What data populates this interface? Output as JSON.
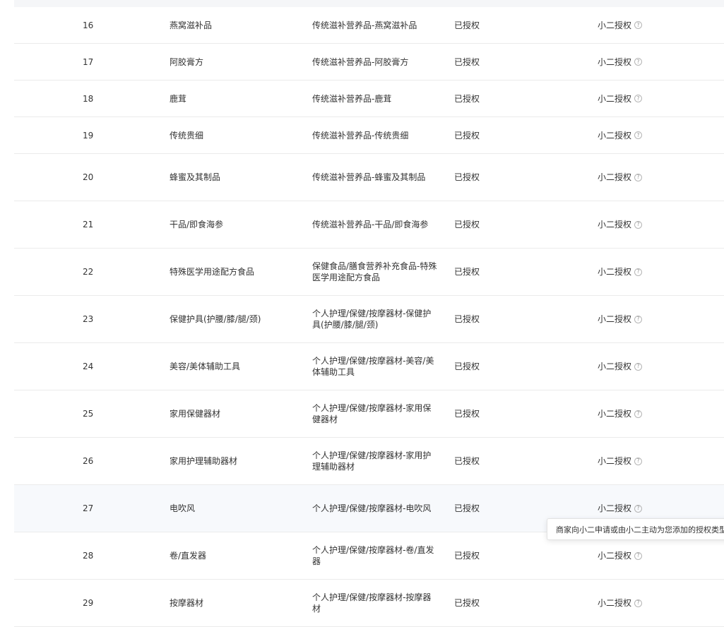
{
  "rows": [
    {
      "index": "16",
      "name": "燕窝滋补品",
      "category_path": "传统滋补营养品-燕窝滋补品",
      "status": "已授权",
      "auth_type": "小二授权"
    },
    {
      "index": "17",
      "name": "阿胶膏方",
      "category_path": "传统滋补营养品-阿胶膏方",
      "status": "已授权",
      "auth_type": "小二授权"
    },
    {
      "index": "18",
      "name": "鹿茸",
      "category_path": "传统滋补营养品-鹿茸",
      "status": "已授权",
      "auth_type": "小二授权"
    },
    {
      "index": "19",
      "name": "传统贵细",
      "category_path": "传统滋补营养品-传统贵细",
      "status": "已授权",
      "auth_type": "小二授权"
    },
    {
      "index": "20",
      "name": "蜂蜜及其制品",
      "category_path": "传统滋补营养品-蜂蜜及其制品",
      "status": "已授权",
      "auth_type": "小二授权"
    },
    {
      "index": "21",
      "name": "干品/即食海参",
      "category_path": "传统滋补营养品-干品/即食海参",
      "status": "已授权",
      "auth_type": "小二授权"
    },
    {
      "index": "22",
      "name": "特殊医学用途配方食品",
      "category_path": "保健食品/膳食营养补充食品-特殊医学用途配方食品",
      "status": "已授权",
      "auth_type": "小二授权"
    },
    {
      "index": "23",
      "name": "保健护具(护腰/膝/腿/颈)",
      "category_path": "个人护理/保健/按摩器材-保健护具(护腰/膝/腿/颈)",
      "status": "已授权",
      "auth_type": "小二授权"
    },
    {
      "index": "24",
      "name": "美容/美体辅助工具",
      "category_path": "个人护理/保健/按摩器材-美容/美体辅助工具",
      "status": "已授权",
      "auth_type": "小二授权"
    },
    {
      "index": "25",
      "name": "家用保健器材",
      "category_path": "个人护理/保健/按摩器材-家用保健器材",
      "status": "已授权",
      "auth_type": "小二授权"
    },
    {
      "index": "26",
      "name": "家用护理辅助器材",
      "category_path": "个人护理/保健/按摩器材-家用护理辅助器材",
      "status": "已授权",
      "auth_type": "小二授权"
    },
    {
      "index": "27",
      "name": "电吹风",
      "category_path": "个人护理/保健/按摩器材-电吹风",
      "status": "已授权",
      "auth_type": "小二授权"
    },
    {
      "index": "28",
      "name": "卷/直发器",
      "category_path": "个人护理/保健/按摩器材-卷/直发器",
      "status": "已授权",
      "auth_type": "小二授权"
    },
    {
      "index": "29",
      "name": "按摩器材",
      "category_path": "个人护理/保健/按摩器材-按摩器材",
      "status": "已授权",
      "auth_type": "小二授权"
    }
  ],
  "help_icon_glyph": "?",
  "tooltip": {
    "text": "商家向小二申请或由小二主动为您添加的授权类型"
  },
  "colors": {
    "row_hover": "#f7f9fc",
    "header_strip": "#f5f6f8",
    "border": "#ebebeb"
  }
}
